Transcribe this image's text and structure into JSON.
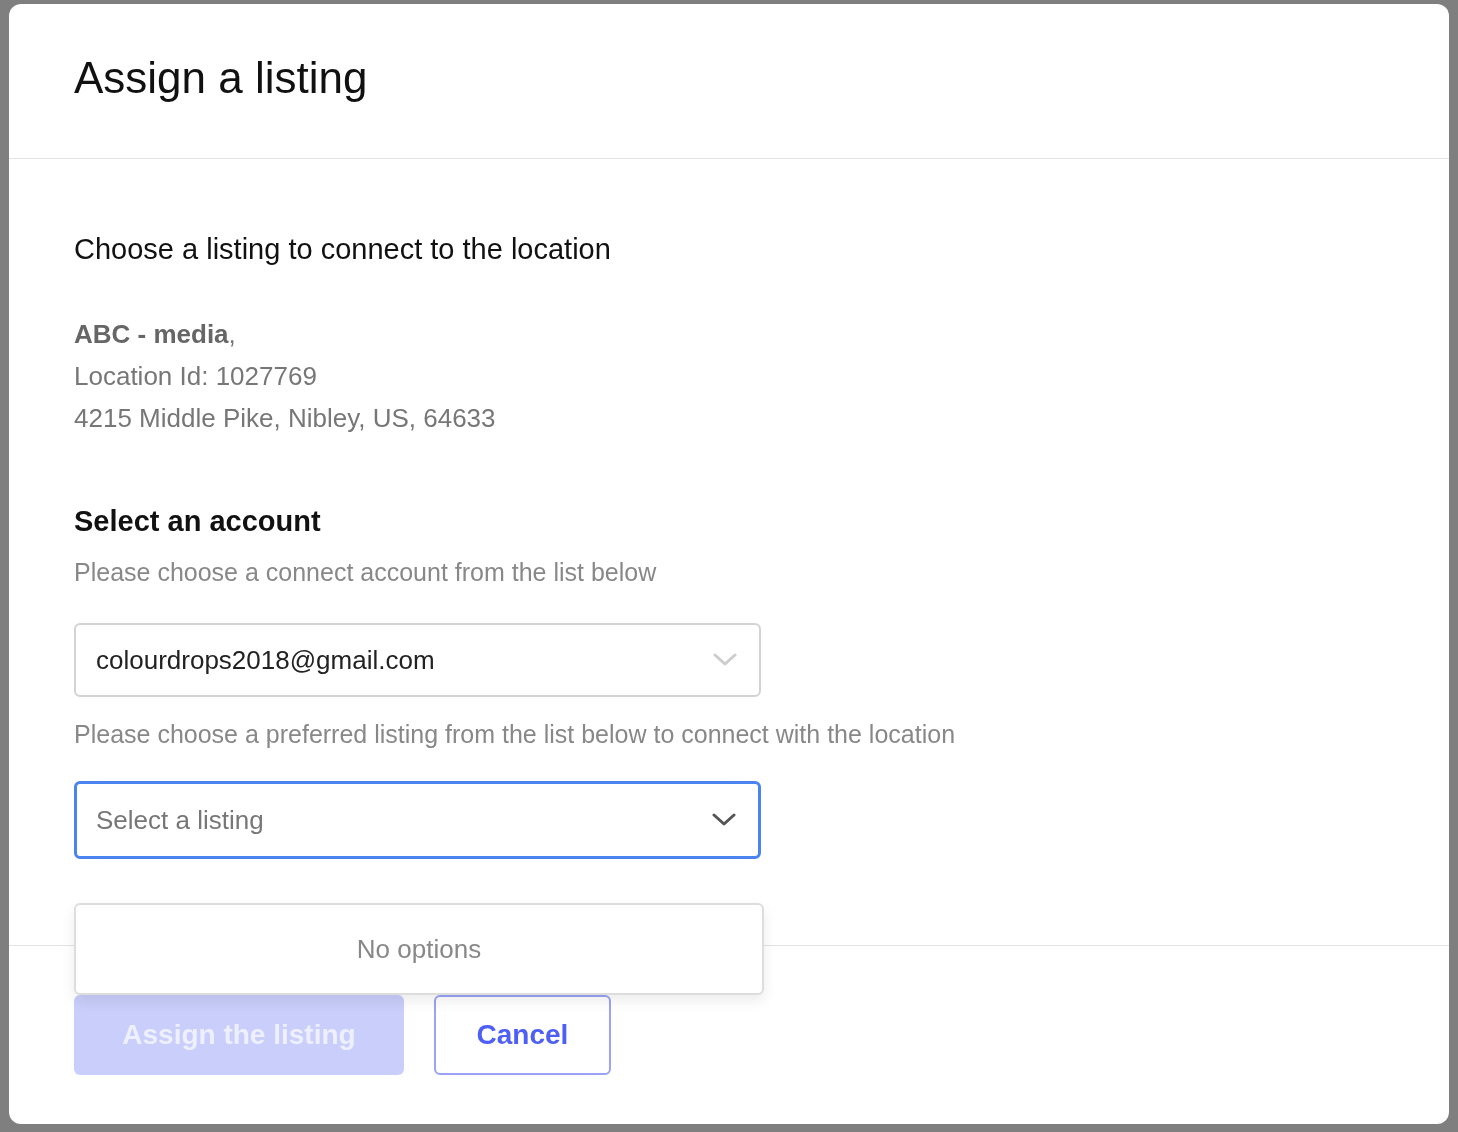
{
  "dialog": {
    "title": "Assign a listing"
  },
  "intro": "Choose a listing to connect to the location",
  "location": {
    "name_line": "**ABC - media**,",
    "id_line": "Location Id: 1027769",
    "address_line": "4215 Middle Pike, Nibley, US, 64633"
  },
  "account_section": {
    "heading": "Select an account",
    "hint": "Please choose a connect account from the list below",
    "select": {
      "value": "colourdrops2018@gmail.com",
      "focused": false
    }
  },
  "listing_section": {
    "hint": "Please choose a preferred listing from the list below to connect with the location",
    "select": {
      "placeholder": "Select a listing",
      "focused": true,
      "open": true
    },
    "menu": {
      "message": "No options"
    }
  },
  "buttons": [
    {
      "label": "Assign the listing",
      "kind": "primary",
      "disabled": true
    },
    {
      "label": "Cancel",
      "kind": "secondary",
      "disabled": false
    }
  ]
}
